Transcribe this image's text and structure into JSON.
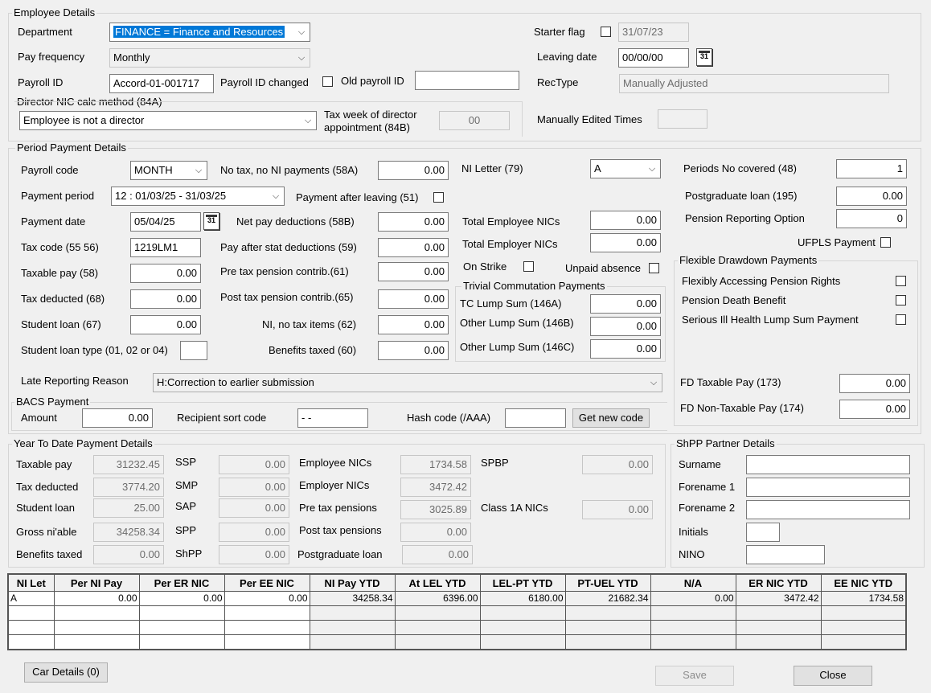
{
  "employee": {
    "title": "Employee Details",
    "department_label": "Department",
    "department_value": "FINANCE    = Finance and Resources",
    "pay_frequency_label": "Pay frequency",
    "pay_frequency_value": "Monthly",
    "payroll_id_label": "Payroll ID",
    "payroll_id_value": "Accord-01-001717",
    "payroll_id_changed_label": "Payroll ID changed",
    "old_payroll_id_label": "Old payroll ID",
    "old_payroll_id_value": "",
    "director_nic_label": "Director NIC calc method (84A)",
    "director_nic_value": "Employee is not a director",
    "tax_week_label": "Tax week of director appointment (84B)",
    "tax_week_value": "00",
    "starter_flag_label": "Starter flag",
    "starter_flag_date": "31/07/23",
    "leaving_date_label": "Leaving date",
    "leaving_date_value": "00/00/00",
    "rectype_label": "RecType",
    "rectype_value": "Manually Adjusted",
    "manually_edited_label": "Manually Edited Times",
    "manually_edited_value": ""
  },
  "period": {
    "title": "Period Payment Details",
    "payroll_code_label": "Payroll code",
    "payroll_code_value": "MONTH",
    "payment_period_label": "Payment period",
    "payment_period_value": "12 : 01/03/25 - 31/03/25",
    "payment_date_label": "Payment date",
    "payment_date_value": "05/04/25",
    "tax_code_label": "Tax code (55  56)",
    "tax_code_value": "1219LM1",
    "taxable_pay_label": "Taxable pay (58)",
    "taxable_pay_value": "0.00",
    "tax_deducted_label": "Tax deducted (68)",
    "tax_deducted_value": "0.00",
    "student_loan_label": "Student loan (67)",
    "student_loan_value": "0.00",
    "student_loan_type_label": "Student loan type (01, 02 or 04)",
    "student_loan_type_value": "",
    "no_tax_label": "No tax, no NI payments (58A)",
    "no_tax_value": "0.00",
    "payment_after_leaving_label": "Payment after leaving (51)",
    "net_pay_deductions_label": "Net pay deductions (58B)",
    "net_pay_deductions_value": "0.00",
    "pay_after_stat_label": "Pay after stat deductions (59)",
    "pay_after_stat_value": "0.00",
    "pre_tax_pension_label": "Pre tax pension contrib.(61)",
    "pre_tax_pension_value": "0.00",
    "post_tax_pension_label": "Post tax pension contrib.(65)",
    "post_tax_pension_value": "0.00",
    "ni_no_tax_label": "NI, no tax items (62)",
    "ni_no_tax_value": "0.00",
    "benefits_taxed_label": "Benefits taxed (60)",
    "benefits_taxed_value": "0.00",
    "ni_letter_label": "NI Letter (79)",
    "ni_letter_value": "A",
    "total_ee_nics_label": "Total Employee NICs",
    "total_ee_nics_value": "0.00",
    "total_er_nics_label": "Total Employer NICs",
    "total_er_nics_value": "0.00",
    "on_strike_label": "On Strike",
    "unpaid_absence_label": "Unpaid absence",
    "trivial_title": "Trivial Commutation Payments",
    "tc_lump_label": "TC Lump Sum (146A)",
    "tc_lump_value": "0.00",
    "other_lump_b_label": "Other Lump Sum (146B)",
    "other_lump_b_value": "0.00",
    "other_lump_c_label": "Other Lump Sum (146C)",
    "other_lump_c_value": "0.00",
    "periods_covered_label": "Periods No covered (48)",
    "periods_covered_value": "1",
    "postgrad_loan_label": "Postgraduate loan (195)",
    "postgrad_loan_value": "0.00",
    "pension_reporting_label": "Pension Reporting Option",
    "pension_reporting_value": "0",
    "ufpls_label": "UFPLS Payment",
    "flex_title": "Flexible Drawdown Payments",
    "flex_accessing_label": "Flexibly Accessing Pension Rights",
    "pension_death_label": "Pension Death Benefit",
    "serious_ill_label": "Serious Ill Health Lump Sum Payment",
    "fd_taxable_label": "FD Taxable Pay (173)",
    "fd_taxable_value": "0.00",
    "fd_nontaxable_label": "FD Non-Taxable Pay (174)",
    "fd_nontaxable_value": "0.00",
    "late_reporting_label": "Late Reporting Reason",
    "late_reporting_value": "H:Correction to earlier submission"
  },
  "bacs": {
    "title": "BACS Payment",
    "amount_label": "Amount",
    "amount_value": "0.00",
    "sort_code_label": "Recipient sort code",
    "sort_code_value": " - -",
    "hash_label": "Hash code (/AAA)",
    "hash_value": "",
    "get_code_label": "Get new code"
  },
  "ytd": {
    "title": "Year To Date Payment Details",
    "taxable_pay_label": "Taxable pay",
    "taxable_pay_value": "31232.45",
    "tax_deducted_label": "Tax deducted",
    "tax_deducted_value": "3774.20",
    "student_loan_label": "Student loan",
    "student_loan_value": "25.00",
    "gross_ni_label": "Gross ni'able",
    "gross_ni_value": "34258.34",
    "benefits_label": "Benefits taxed",
    "benefits_value": "0.00",
    "ssp_label": "SSP",
    "ssp_value": "0.00",
    "smp_label": "SMP",
    "smp_value": "0.00",
    "sap_label": "SAP",
    "sap_value": "0.00",
    "spp_label": "SPP",
    "spp_value": "0.00",
    "shpp_label": "ShPP",
    "shpp_value": "0.00",
    "ee_nics_label": "Employee NICs",
    "ee_nics_value": "1734.58",
    "er_nics_label": "Employer NICs",
    "er_nics_value": "3472.42",
    "pre_tax_label": "Pre tax pensions",
    "pre_tax_value": "3025.89",
    "post_tax_label": "Post tax pensions",
    "post_tax_value": "0.00",
    "postgrad_label": "Postgraduate loan",
    "postgrad_value": "0.00",
    "spbp_label": "SPBP",
    "spbp_value": "0.00",
    "class1a_label": "Class 1A NICs",
    "class1a_value": "0.00"
  },
  "shpp": {
    "title": "ShPP Partner Details",
    "surname_label": "Surname",
    "forename1_label": "Forename 1",
    "forename2_label": "Forename 2",
    "initials_label": "Initials",
    "nino_label": "NINO"
  },
  "nic_table": {
    "headers": [
      "NI Let",
      "Per NI Pay",
      "Per ER NIC",
      "Per EE NIC",
      "NI Pay YTD",
      "At LEL YTD",
      "LEL-PT YTD",
      "PT-UEL YTD",
      "N/A",
      "ER NIC YTD",
      "EE NIC YTD"
    ],
    "row1": [
      "A",
      "0.00",
      "0.00",
      "0.00",
      "34258.34",
      "6396.00",
      "6180.00",
      "21682.34",
      "0.00",
      "3472.42",
      "1734.58"
    ]
  },
  "footer": {
    "car_details_label": "Car Details (0)",
    "save_label": "Save",
    "close_label": "Close"
  },
  "icons": {
    "dropdown": "chevron-down-icon",
    "calendar": "calendar-icon"
  }
}
